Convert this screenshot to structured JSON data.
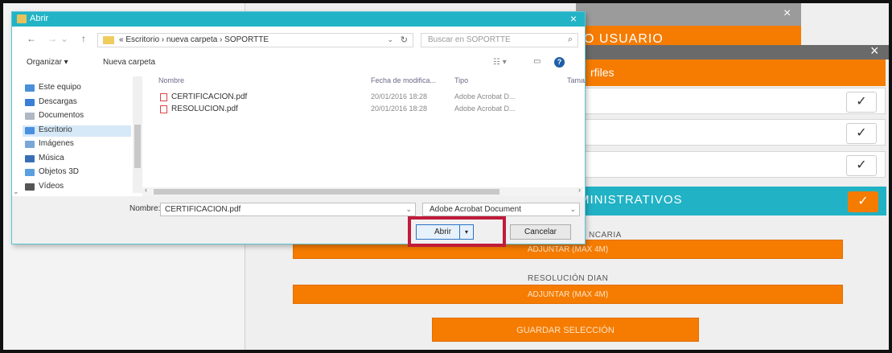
{
  "background_app": {
    "close_top": "×",
    "orange_header": "O USUARIO",
    "close_second": "×",
    "perfiles": "rfiles",
    "check": "✓",
    "admin_label": "MINISTRATIVOS",
    "cert_label": "NCARIA",
    "resol_label": "RESOLUCIÓN DIAN",
    "adjuntar1": "ADJUNTAR (MAX 4M)",
    "adjuntar2": "ADJUNTAR (MAX 4M)",
    "guardar": "GUARDAR SELECCIÓN"
  },
  "dialog": {
    "title": "Abrir",
    "close": "×",
    "nav": {
      "back": "←",
      "forward": "→",
      "recent": "⌄",
      "up": "↑"
    },
    "breadcrumb": "« Escritorio  ›  nueva carpeta  ›  SOPORTTE",
    "address_dropdown": "⌄",
    "refresh": "↻",
    "search_placeholder": "Buscar en SOPORTTE",
    "search_icon": "⌕",
    "toolbar": {
      "organize": "Organizar ▾",
      "new_folder": "Nueva carpeta",
      "view": "☷ ▾",
      "pane": "▭",
      "help": "?"
    },
    "sidebar": [
      {
        "label": "Este equipo",
        "icon": "computer-icon",
        "color": "#4a90d9",
        "selected": false
      },
      {
        "label": "Descargas",
        "icon": "download-icon",
        "color": "#3a7fd5",
        "selected": false
      },
      {
        "label": "Documentos",
        "icon": "documents-icon",
        "color": "#b0b8c4",
        "selected": false
      },
      {
        "label": "Escritorio",
        "icon": "desktop-icon",
        "color": "#4a8fe0",
        "selected": true
      },
      {
        "label": "Imágenes",
        "icon": "images-icon",
        "color": "#7aa6d8",
        "selected": false
      },
      {
        "label": "Música",
        "icon": "music-icon",
        "color": "#3a6fb8",
        "selected": false
      },
      {
        "label": "Objetos 3D",
        "icon": "objects3d-icon",
        "color": "#5aa0e0",
        "selected": false
      },
      {
        "label": "Vídeos",
        "icon": "videos-icon",
        "color": "#555555",
        "selected": false
      }
    ],
    "columns": {
      "name": "Nombre",
      "date": "Fecha de modifica...",
      "type": "Tipo",
      "size": "Tama"
    },
    "files": [
      {
        "name": "CERTIFICACION.pdf",
        "date": "20/01/2016 18:28",
        "type": "Adobe Acrobat D..."
      },
      {
        "name": "RESOLUCION.pdf",
        "date": "20/01/2016 18:28",
        "type": "Adobe Acrobat D..."
      }
    ],
    "filename_label": "Nombre:",
    "filename_value": "CERTIFICACION.pdf",
    "filetype": "Adobe Acrobat Document",
    "open_button": "Abrir",
    "open_split": "▾",
    "cancel_button": "Cancelar",
    "arrow_left": "‹",
    "arrow_right": "›",
    "side_arrow": "⌄"
  }
}
